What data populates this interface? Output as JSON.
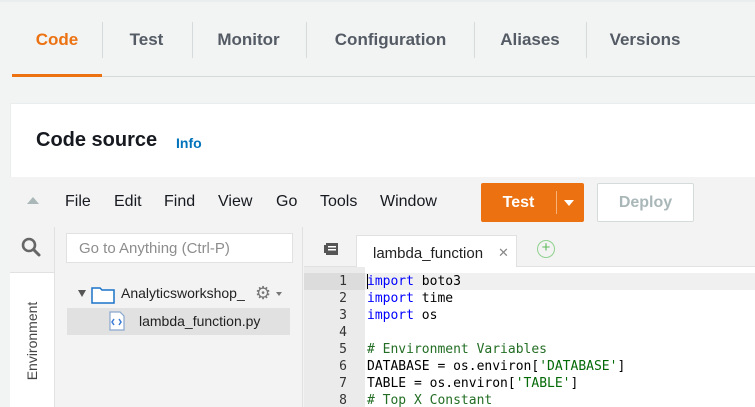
{
  "tabs": [
    {
      "label": "Code",
      "active": true
    },
    {
      "label": "Test",
      "active": false
    },
    {
      "label": "Monitor",
      "active": false
    },
    {
      "label": "Configuration",
      "active": false
    },
    {
      "label": "Aliases",
      "active": false
    },
    {
      "label": "Versions",
      "active": false
    }
  ],
  "panel": {
    "title": "Code source",
    "info_link": "Info"
  },
  "menu": [
    "File",
    "Edit",
    "Find",
    "View",
    "Go",
    "Tools",
    "Window"
  ],
  "buttons": {
    "test": "Test",
    "deploy": "Deploy"
  },
  "sidebar": {
    "search_placeholder": "Go to Anything (Ctrl-P)",
    "environment_label": "Environment"
  },
  "tree": {
    "folder": "Analyticsworkshop_",
    "files": [
      "lambda_function.py"
    ]
  },
  "editor": {
    "tab_label": "lambda_function",
    "current_line": 1,
    "lines": [
      {
        "n": "1",
        "tokens": [
          {
            "t": "import",
            "c": "kw"
          },
          {
            "t": " boto3",
            "c": ""
          }
        ]
      },
      {
        "n": "2",
        "tokens": [
          {
            "t": "import",
            "c": "kw"
          },
          {
            "t": " time",
            "c": ""
          }
        ]
      },
      {
        "n": "3",
        "tokens": [
          {
            "t": "import",
            "c": "kw"
          },
          {
            "t": " os",
            "c": ""
          }
        ]
      },
      {
        "n": "4",
        "tokens": []
      },
      {
        "n": "5",
        "tokens": [
          {
            "t": "# Environment Variables",
            "c": "cmt"
          }
        ]
      },
      {
        "n": "6",
        "tokens": [
          {
            "t": "DATABASE = os.environ[",
            "c": ""
          },
          {
            "t": "'DATABASE'",
            "c": "str"
          },
          {
            "t": "]",
            "c": ""
          }
        ]
      },
      {
        "n": "7",
        "tokens": [
          {
            "t": "TABLE = os.environ[",
            "c": ""
          },
          {
            "t": "'TABLE'",
            "c": "str"
          },
          {
            "t": "]",
            "c": ""
          }
        ]
      },
      {
        "n": "8",
        "tokens": [
          {
            "t": "# Top X Constant",
            "c": "cmt"
          }
        ]
      }
    ]
  },
  "colors": {
    "accent": "#ec7211",
    "link": "#0073bb"
  }
}
